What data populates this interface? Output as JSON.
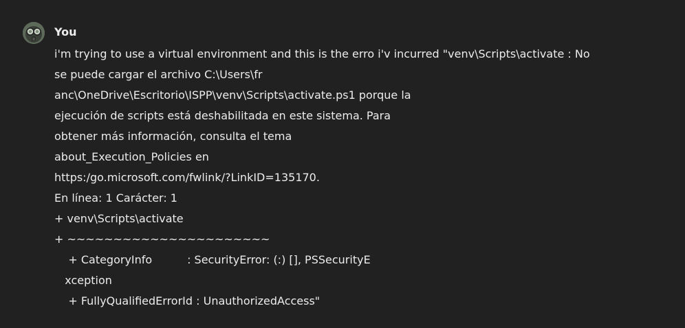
{
  "message": {
    "author": "You",
    "avatar_icon": "gas-mask-avatar-icon",
    "lines": [
      "i'm trying to use a virtual environment and this is the erro i'v incurred \"venv\\Scripts\\activate : No",
      "se puede cargar el archivo C:\\Users\\fr",
      "anc\\OneDrive\\Escritorio\\ISPP\\venv\\Scripts\\activate.ps1 porque la",
      "ejecución de scripts está deshabilitada en este sistema. Para",
      "obtener más información, consulta el tema",
      "about_Execution_Policies en",
      "https:/go.microsoft.com/fwlink/?LinkID=135170.",
      "En línea: 1 Carácter: 1",
      "+ venv\\Scripts\\activate",
      "+ ~~~~~~~~~~~~~~~~~~~~~~",
      "    + CategoryInfo          : SecurityError: (:) [], PSSecurityE",
      "   xception",
      "    + FullyQualifiedErrorId : UnauthorizedAccess\""
    ]
  },
  "colors": {
    "background": "#212121",
    "text": "#ececec",
    "avatar_bg": "#6a7466"
  }
}
